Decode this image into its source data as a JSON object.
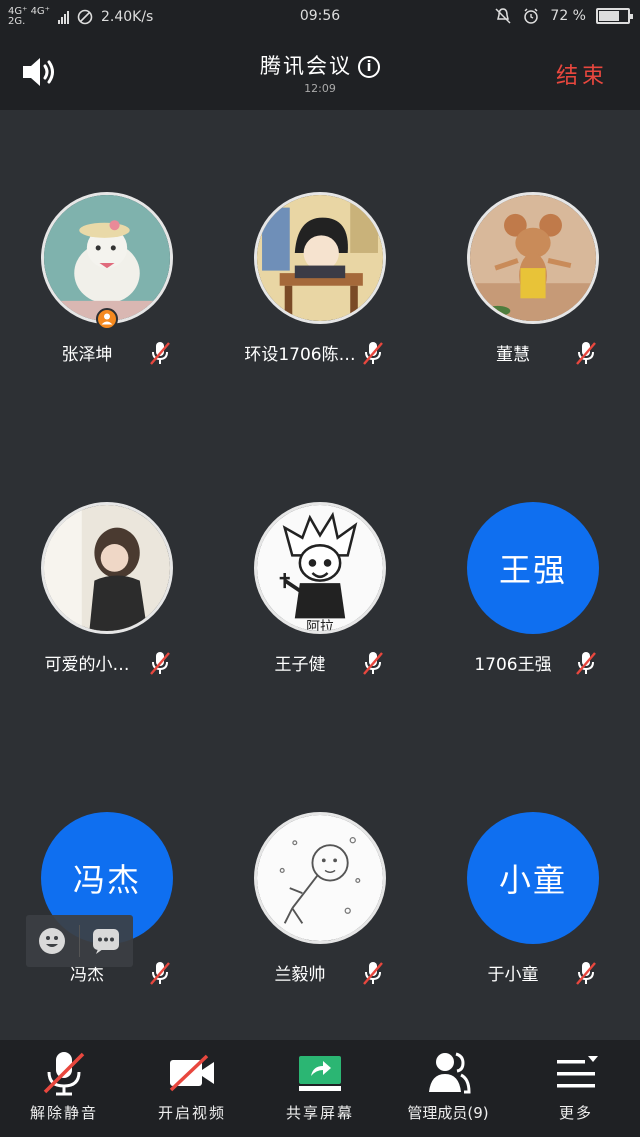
{
  "status_bar": {
    "network_top": "4G⁺ 4G⁺",
    "network_bottom": "2G.",
    "speed": "2.40K/s",
    "time": "09:56",
    "battery": "72 %",
    "battery_level": 0.72
  },
  "header": {
    "title": "腾讯会议",
    "timer": "12:09",
    "end_label": "结束"
  },
  "participants": [
    {
      "name": "张泽坤",
      "avatar_type": "photo",
      "avatar_icon": "bird-hat-avatar",
      "is_host": true,
      "muted": true
    },
    {
      "name": "环设1706陈…",
      "avatar_type": "photo",
      "avatar_icon": "anime-student-avatar",
      "is_host": false,
      "muted": true
    },
    {
      "name": "董慧",
      "avatar_type": "photo",
      "avatar_icon": "cartoon-mouse-avatar",
      "is_host": false,
      "muted": true
    },
    {
      "name": "可爱的小…",
      "avatar_type": "photo",
      "avatar_icon": "girl-photo-avatar",
      "is_host": false,
      "muted": true
    },
    {
      "name": "王子健",
      "avatar_type": "photo",
      "avatar_icon": "manga-character-avatar",
      "is_host": false,
      "muted": true,
      "avatar_caption": "阿拉"
    },
    {
      "name": "1706王强",
      "avatar_type": "text",
      "avatar_text": "王强",
      "is_host": false,
      "muted": true
    },
    {
      "name": "冯杰",
      "avatar_type": "text",
      "avatar_text": "冯杰",
      "is_host": false,
      "muted": true
    },
    {
      "name": "兰毅帅",
      "avatar_type": "photo",
      "avatar_icon": "sketch-doodle-avatar",
      "is_host": false,
      "muted": true
    },
    {
      "name": "于小童",
      "avatar_type": "text",
      "avatar_text": "小童",
      "is_host": false,
      "muted": true
    }
  ],
  "float_bar": {
    "emoji_icon": "emoji-icon",
    "chat_icon": "chat-icon"
  },
  "toolbar": {
    "unmute_label": "解除静音",
    "video_label": "开启视频",
    "share_label": "共享屏幕",
    "members_label": "管理成员(9)",
    "more_label": "更多"
  },
  "colors": {
    "background": "#2d3034",
    "bar": "#1f2124",
    "text_avatar": "#0f6ff0",
    "end": "#e8473e",
    "host_badge": "#f5891f",
    "share_icon": "#2bb673",
    "muted_slash": "#e8473e"
  }
}
